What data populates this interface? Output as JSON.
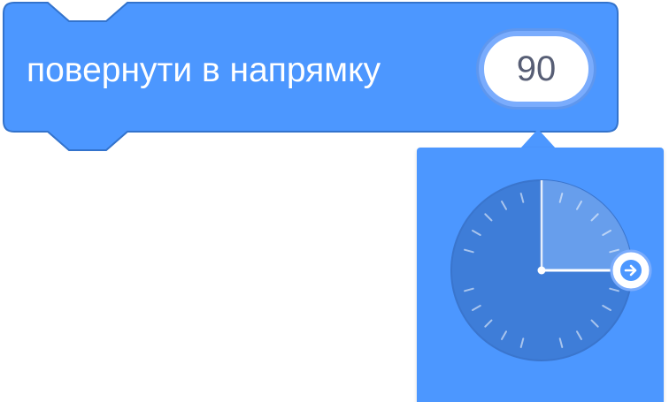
{
  "block": {
    "label": "повернути в напрямку",
    "value": "90",
    "color": "#4C97FF",
    "border_color": "#3373CC"
  },
  "angle_dial": {
    "angle_degrees": 90,
    "handle_icon": "arrow-right-icon",
    "face_color": "#3E7DD8"
  }
}
